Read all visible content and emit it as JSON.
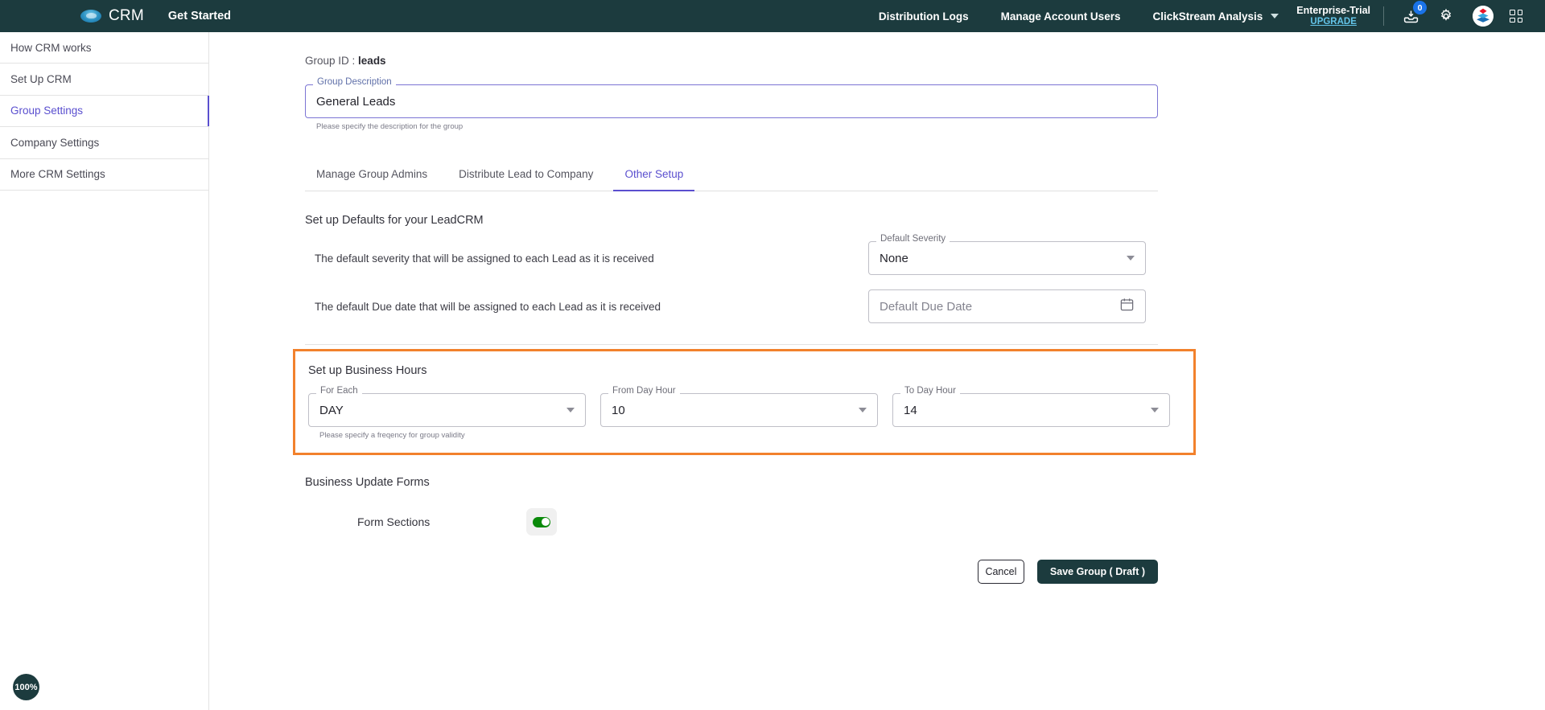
{
  "header": {
    "brand": "CRM",
    "logo_icon": "cloud-logo-icon",
    "get_started": "Get Started",
    "nav": [
      {
        "label": "Distribution Logs",
        "name": "nav-distribution-logs"
      },
      {
        "label": "Manage Account Users",
        "name": "nav-manage-account-users"
      },
      {
        "label": "ClickStream Analysis",
        "name": "nav-clickstream-analysis"
      }
    ],
    "plan": {
      "name": "Enterprise-Trial",
      "upgrade": "UPGRADE"
    },
    "inbox_badge": "0",
    "icons": {
      "caret": "chevron-down-icon",
      "inbox": "inbox-download-icon",
      "gear": "gear-icon",
      "avatar": "app-avatar-icon",
      "apps": "apps-grid-icon"
    }
  },
  "sidebar": {
    "items": [
      {
        "label": "How CRM works",
        "active": false
      },
      {
        "label": "Set Up CRM",
        "active": false
      },
      {
        "label": "Group Settings",
        "active": true
      },
      {
        "label": "Company Settings",
        "active": false
      },
      {
        "label": "More CRM Settings",
        "active": false
      }
    ],
    "accent_color": "#5a4fcf"
  },
  "main": {
    "group_id_label": "Group ID :",
    "group_id_value": "leads",
    "group_description": {
      "label": "Group Description",
      "value": "General Leads",
      "helper": "Please specify the description for the group"
    },
    "tabs": [
      {
        "label": "Manage Group Admins",
        "active": false
      },
      {
        "label": "Distribute Lead to Company",
        "active": false
      },
      {
        "label": "Other Setup",
        "active": true
      }
    ],
    "defaults": {
      "title": "Set up Defaults for your LeadCRM",
      "rows": [
        {
          "text": "The default severity that will be assigned to each Lead as it is received",
          "field_label": "Default Severity",
          "field_value": "None",
          "control": "select"
        },
        {
          "text": "The default Due date that will be assigned to each Lead as it is received",
          "field_label": "",
          "field_value": "Default Due Date",
          "control": "date"
        }
      ]
    },
    "business_hours": {
      "title": "Set up Business Hours",
      "border_color": "#f2812c",
      "fields": [
        {
          "label": "For Each",
          "value": "DAY",
          "helper": "Please specify a freqency for group validity"
        },
        {
          "label": "From Day Hour",
          "value": "10",
          "helper": ""
        },
        {
          "label": "To Day Hour",
          "value": "14",
          "helper": ""
        }
      ]
    },
    "business_update_forms": {
      "title": "Business Update Forms",
      "form_sections_label": "Form Sections",
      "form_sections_on": true,
      "toggle_color": "#0a8a0a"
    },
    "actions": {
      "cancel": "Cancel",
      "save": "Save Group ( Draft )"
    }
  },
  "zoom_badge": "100%"
}
